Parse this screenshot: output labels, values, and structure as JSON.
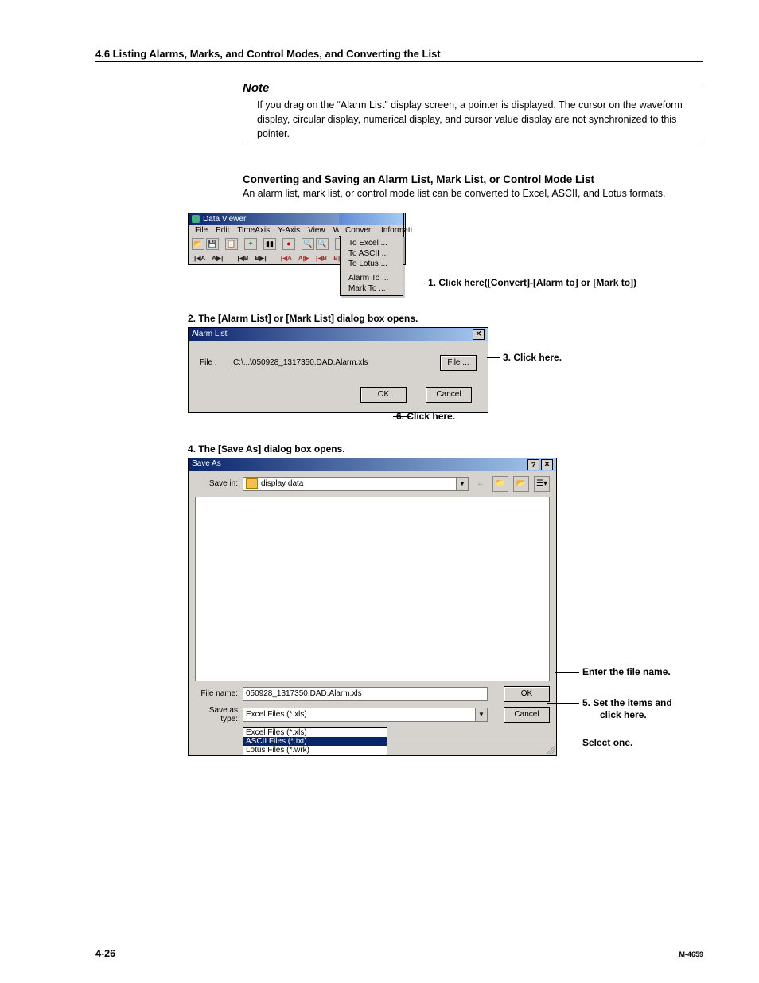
{
  "page": {
    "section_header": "4.6  Listing Alarms, Marks, and Control Modes, and Converting the List",
    "page_number": "4-26",
    "doc_id": "M-4659"
  },
  "note": {
    "title": "Note",
    "body": "If you drag on the “Alarm List” display screen, a pointer is displayed.  The cursor on the waveform display, circular display, numerical display, and cursor value display are not synchronized to this pointer."
  },
  "convert_section": {
    "heading": "Converting and Saving an Alarm List, Mark List, or Control Mode List",
    "para": "An alarm list, mark list, or control mode list can be converted to Excel, ASCII, and Lotus formats."
  },
  "data_viewer": {
    "title": "Data Viewer",
    "menu": {
      "file": "File",
      "edit": "Edit",
      "timeaxis": "TimeAxis",
      "yaxis": "Y-Axis",
      "view": "View",
      "window": "Window",
      "convert": "Convert",
      "information": "Informati"
    },
    "dropdown": {
      "to_excel": "To Excel ...",
      "to_ascii": "To ASCII ...",
      "to_lotus": "To Lotus ...",
      "alarm_to": "Alarm To ...",
      "mark_to": "Mark To ..."
    }
  },
  "callouts": {
    "c1": "1. Click here([Convert]-[Alarm to] or [Mark to])",
    "step2": "2. The [Alarm List] or [Mark List] dialog box opens.",
    "c3": "3. Click here.",
    "c6": "6. Click here.",
    "step4": "4. The [Save As] dialog box opens.",
    "enter_name": "Enter the file name.",
    "c5a": "5. Set the items and",
    "c5b": "click here.",
    "select_one": "Select one."
  },
  "alarm_list_dlg": {
    "title": "Alarm List",
    "file_label": "File :",
    "file_path": "C:\\...\\050928_1317350.DAD.Alarm.xls",
    "file_btn": "File ...",
    "ok": "OK",
    "cancel": "Cancel"
  },
  "save_as": {
    "title": "Save As",
    "savein_label": "Save in:",
    "savein_value": "display data",
    "filename_label": "File name:",
    "filename_value": "050928_1317350.DAD.Alarm.xls",
    "saveastype_label": "Save as type:",
    "saveastype_value": "Excel Files (*.xls)",
    "ok": "OK",
    "cancel": "Cancel",
    "type_options": {
      "excel": "Excel Files (*.xls)",
      "ascii": "ASCII Files (*.txt)",
      "lotus": "Lotus Files (*.wrk)"
    }
  }
}
